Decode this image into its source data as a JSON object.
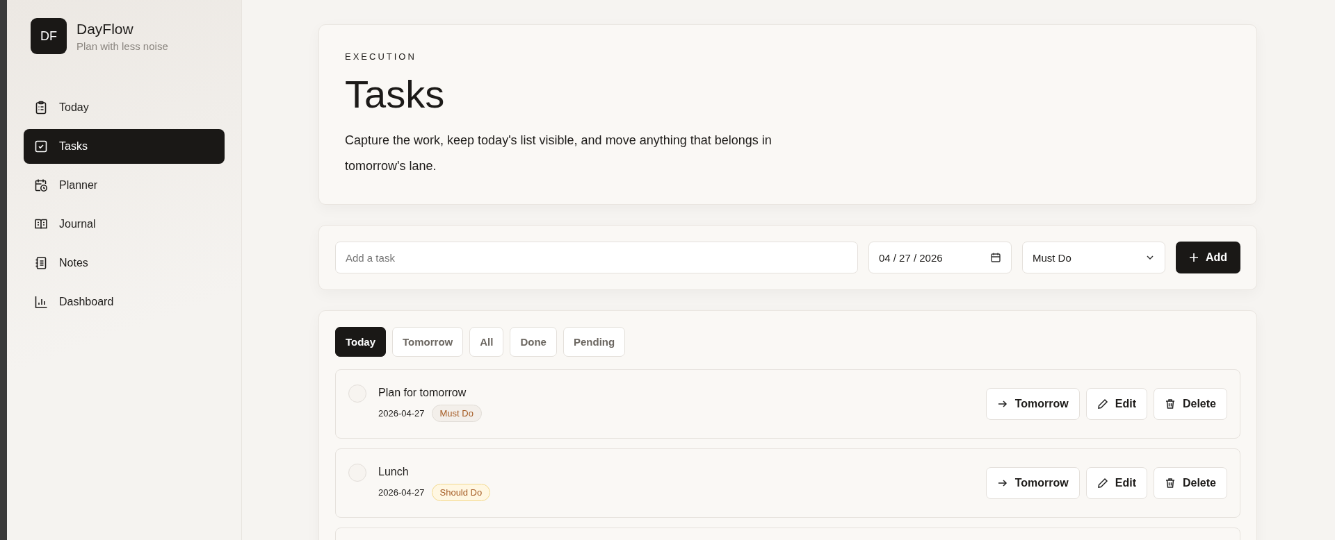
{
  "brand": {
    "logo": "DF",
    "name": "DayFlow",
    "tagline": "Plan with less noise"
  },
  "nav": [
    {
      "label": "Today",
      "kind": "clipboard",
      "selected": false
    },
    {
      "label": "Tasks",
      "kind": "check",
      "selected": true
    },
    {
      "label": "Planner",
      "kind": "calendar",
      "selected": false
    },
    {
      "label": "Journal",
      "kind": "book",
      "selected": false
    },
    {
      "label": "Notes",
      "kind": "notebook",
      "selected": false
    },
    {
      "label": "Dashboard",
      "kind": "chart",
      "selected": false
    }
  ],
  "header": {
    "eyebrow": "EXECUTION",
    "title": "Tasks",
    "description": "Capture the work, keep today's list visible, and move anything that belongs in tomorrow's lane."
  },
  "form": {
    "task_placeholder": "Add a task",
    "date": "04 / 27 / 2026",
    "priority": "Must Do",
    "add_button": "Add"
  },
  "filters": [
    {
      "label": "Today",
      "selected": true
    },
    {
      "label": "Tomorrow",
      "selected": false
    },
    {
      "label": "All",
      "selected": false
    },
    {
      "label": "Done",
      "selected": false
    },
    {
      "label": "Pending",
      "selected": false
    }
  ],
  "tasks": [
    {
      "title": "Plan for tomorrow",
      "date": "2026-04-27",
      "priority": {
        "label": "Must Do",
        "kind": "must"
      },
      "done": false,
      "actions": [
        "Tomorrow",
        "Edit",
        "Delete"
      ]
    },
    {
      "title": "Lunch",
      "date": "2026-04-27",
      "priority": {
        "label": "Should Do",
        "kind": "should"
      },
      "done": false,
      "actions": [
        "Tomorrow",
        "Edit",
        "Delete"
      ]
    }
  ]
}
